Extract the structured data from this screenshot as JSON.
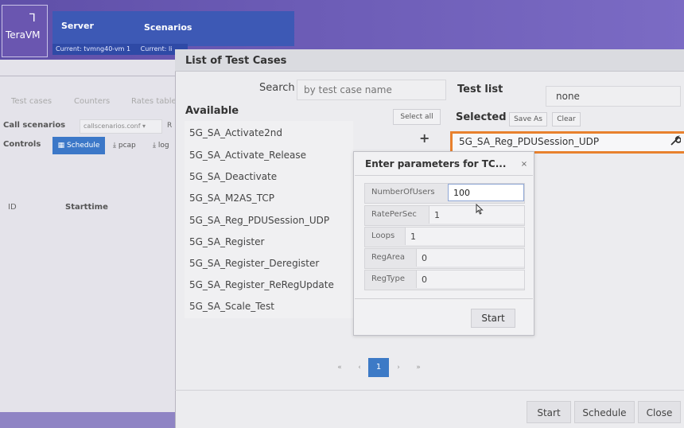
{
  "app": {
    "logo_text": "TeraVM",
    "nav": {
      "server": "Server",
      "scenarios": "Scenarios"
    },
    "status": {
      "current_vm": "Current: tvmng40-vm 1",
      "current_other": "Current: li"
    }
  },
  "background": {
    "tabs": [
      "Test cases",
      "Counters",
      "Rates table"
    ],
    "call_scenarios_label": "Call scenarios",
    "call_scenarios_value": "callscenarios.conf",
    "call_scenarios_extra": "R",
    "controls_label": "Controls",
    "schedule_btn": "Schedule",
    "pcap_btn": "pcap",
    "log_btn": "log",
    "table_headers": [
      "ID",
      "Starttime"
    ]
  },
  "dialog": {
    "title": "List of Test Cases",
    "search_label": "Search",
    "search_placeholder": "by test case name",
    "test_list_label": "Test list",
    "test_list_value": "none",
    "available_label": "Available",
    "select_all": "Select all",
    "selected_label": "Selected",
    "save_as": "Save As",
    "clear": "Clear",
    "available_items": [
      "5G_SA_Activate2nd",
      "5G_SA_Activate_Release",
      "5G_SA_Deactivate",
      "5G_SA_M2AS_TCP",
      "5G_SA_Reg_PDUSession_UDP",
      "5G_SA_Register",
      "5G_SA_Register_Deregister",
      "5G_SA_Register_ReRegUpdate",
      "5G_SA_Scale_Test"
    ],
    "selected_items": [
      "5G_SA_Reg_PDUSession_UDP"
    ],
    "pagination": {
      "first": "«",
      "prev": "‹",
      "current": "1",
      "next": "›",
      "last": "»"
    },
    "footer": {
      "start": "Start",
      "schedule": "Schedule",
      "close": "Close"
    }
  },
  "params_popup": {
    "title": "Enter parameters for TC...",
    "close": "×",
    "fields": [
      {
        "label": "NumberOfUsers",
        "value": "100"
      },
      {
        "label": "RatePerSec",
        "value": "1"
      },
      {
        "label": "Loops",
        "value": "1"
      },
      {
        "label": "RegArea",
        "value": "0"
      },
      {
        "label": "RegType",
        "value": "0"
      }
    ],
    "start": "Start"
  },
  "icons": {
    "plus": "+",
    "wrench": "wrench-icon",
    "calendar": "calendar-icon",
    "download": "download-icon"
  },
  "colors": {
    "accent": "#3d7ac6",
    "highlight": "#e8812e",
    "header": "#6c5cb6"
  }
}
